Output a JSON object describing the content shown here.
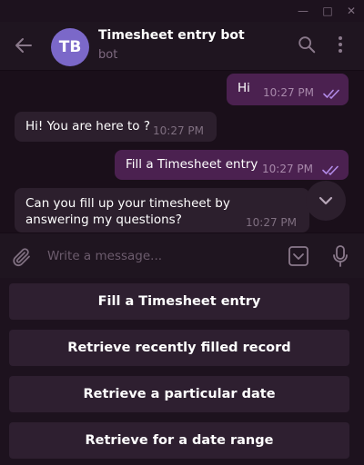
{
  "window": {
    "minimize": "—",
    "maximize": "□",
    "close": "✕"
  },
  "header": {
    "avatar_initials": "TB",
    "title": "Timesheet entry bot",
    "subtitle": "bot",
    "icons": {
      "back": "back-arrow-icon",
      "search": "search-icon",
      "more": "more-vertical-icon"
    }
  },
  "messages": [
    {
      "direction": "outgoing",
      "text": "Hi",
      "time": "10:27 PM",
      "status": "read"
    },
    {
      "direction": "incoming",
      "text": "Hi! You are here to ?",
      "time": "10:27 PM"
    },
    {
      "direction": "outgoing",
      "text": "Fill a Timesheet entry",
      "time": "10:27 PM",
      "status": "read"
    },
    {
      "direction": "incoming",
      "text": "Can you fill up your timesheet by answering my questions?",
      "time": "10:27 PM"
    }
  ],
  "composer": {
    "placeholder": "Write a message..."
  },
  "bot_keyboard": [
    "Fill a Timesheet entry",
    "Retrieve recently filled record",
    "Retrieve a particular date",
    "Retrieve for a date range"
  ],
  "colors": {
    "background": "#1a0f1a",
    "outgoing_bubble": "#4b2150",
    "incoming_bubble": "#2c1f2d",
    "accent": "#b18ae6",
    "avatar": "#7b68c9"
  }
}
